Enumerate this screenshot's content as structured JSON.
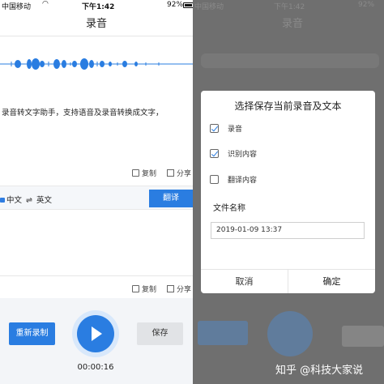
{
  "status_bar": {
    "carrier": "中国移动",
    "time": "下午1:42",
    "battery": "92%"
  },
  "nav": {
    "title": "录音"
  },
  "transcript": "录音转文字助手，支持语音及录音转换成文字，",
  "actions": {
    "copy": "复制",
    "share": "分享"
  },
  "translation": {
    "source_lang": "中文",
    "swap_symbol": "⇌",
    "target_lang": "英文",
    "translate_button": "翻译"
  },
  "controls": {
    "rerecord_button": "重新录制",
    "save_button": "保存",
    "timer": "00:00:16"
  },
  "dialog": {
    "title": "选择保存当前录音及文本",
    "options": [
      {
        "label": "录音",
        "checked": true
      },
      {
        "label": "识别内容",
        "checked": true
      },
      {
        "label": "翻译内容",
        "checked": false
      }
    ],
    "filename_label": "文件名称",
    "filename_value": "2019-01-09 13:37",
    "cancel_button": "取消",
    "confirm_button": "确定"
  },
  "watermark": "知乎 @科技大家说",
  "colors": {
    "accent": "#2a7de1",
    "overlay": "#6f6f6f",
    "bottom_bg": "#f3f5f8"
  }
}
